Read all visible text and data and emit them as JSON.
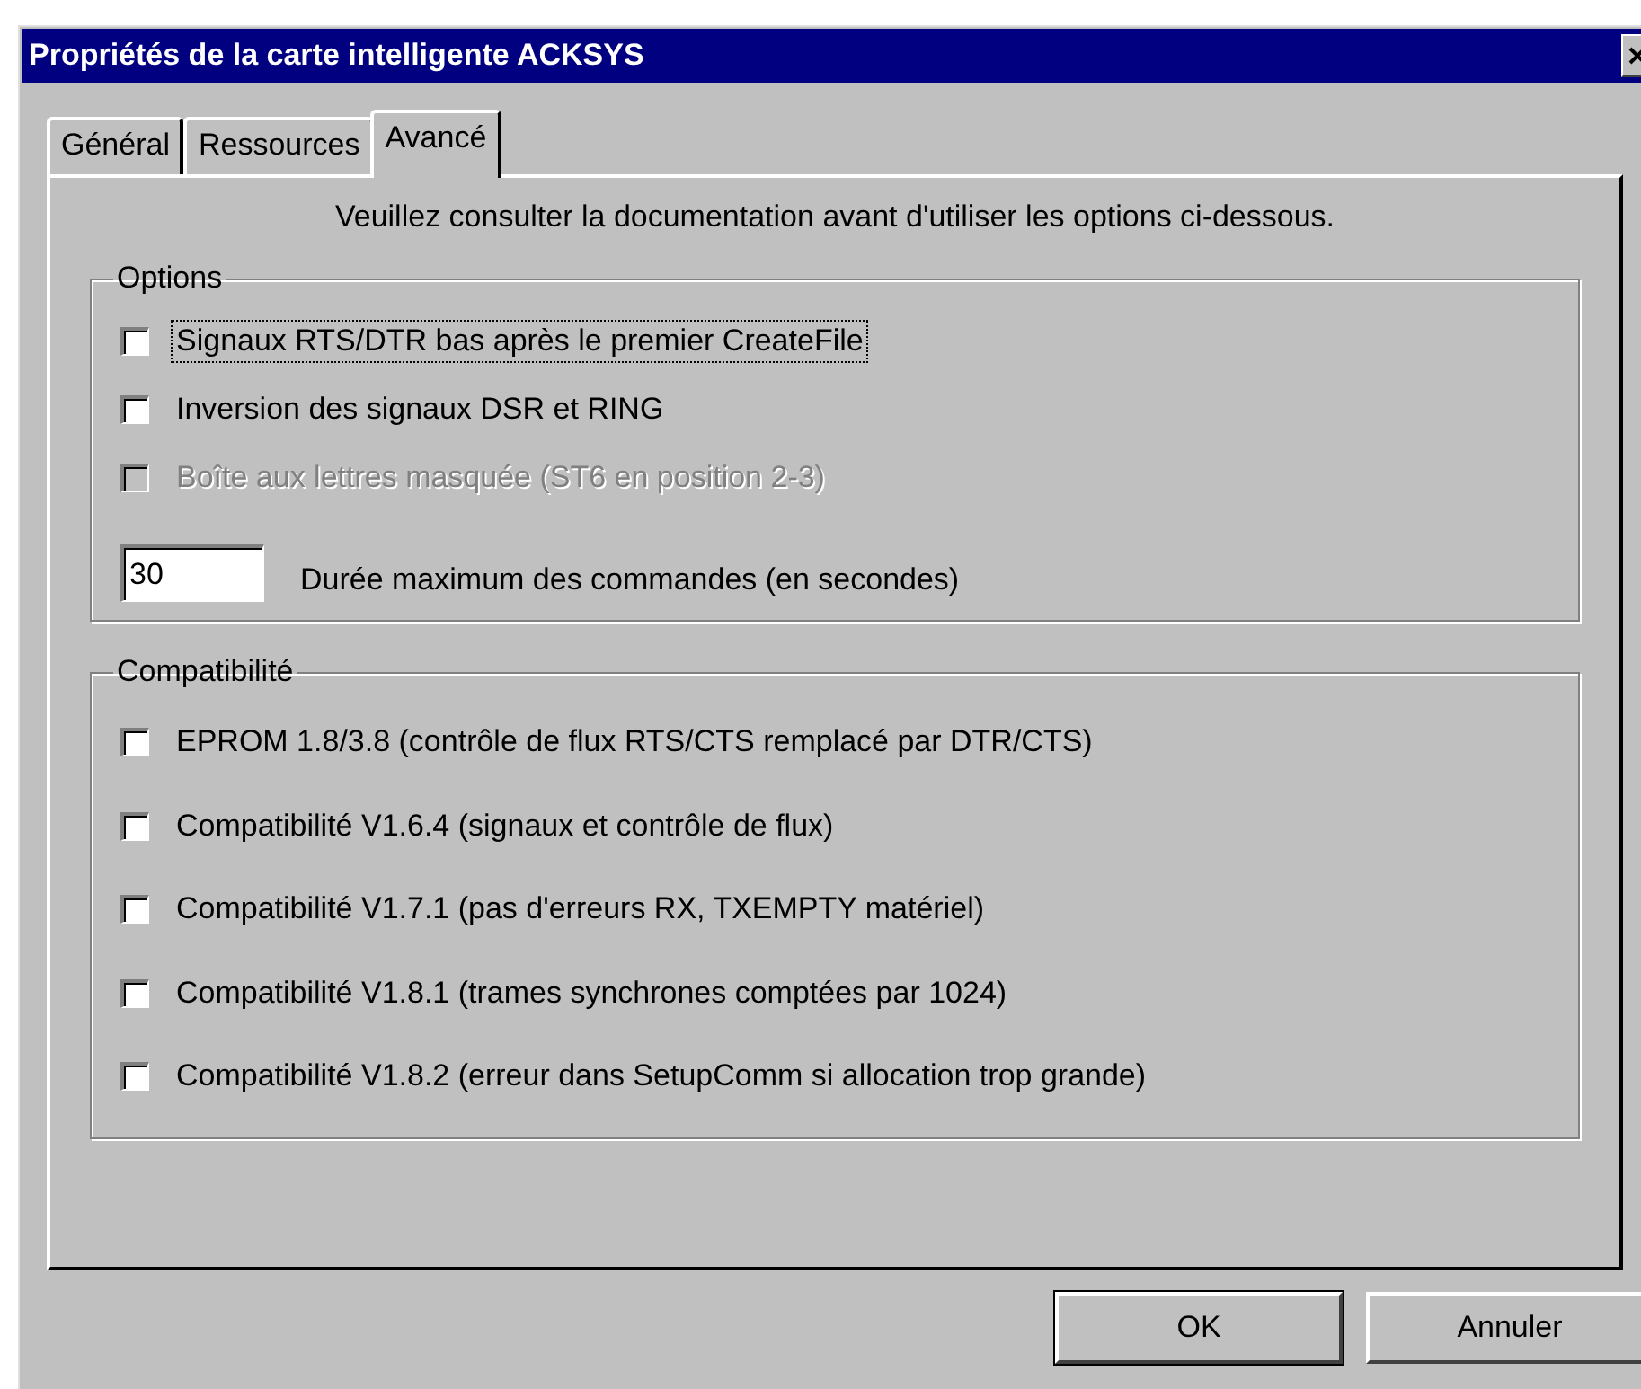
{
  "window": {
    "title": "Propriétés de la carte intelligente ACKSYS"
  },
  "tabs": [
    {
      "label": "Général",
      "selected": false
    },
    {
      "label": "Ressources",
      "selected": false
    },
    {
      "label": "Avancé",
      "selected": true
    }
  ],
  "notice": "Veuillez consulter la documentation avant d'utiliser les options ci-dessous.",
  "options": {
    "title": "Options",
    "checkboxes": [
      {
        "label": "Signaux RTS/DTR bas après le premier CreateFile",
        "checked": false,
        "disabled": false,
        "focused": true
      },
      {
        "label": "Inversion des signaux DSR et RING",
        "checked": false,
        "disabled": false,
        "focused": false
      },
      {
        "label": "Boîte aux lettres masquée (ST6 en position 2-3)",
        "checked": false,
        "disabled": true,
        "focused": false
      }
    ],
    "timeout": {
      "value": "30",
      "label": "Durée maximum des commandes (en secondes)"
    }
  },
  "compatibility": {
    "title": "Compatibilité",
    "checkboxes": [
      {
        "label": "EPROM 1.8/3.8 (contrôle de flux RTS/CTS remplacé par DTR/CTS)",
        "checked": false,
        "disabled": false,
        "focused": false
      },
      {
        "label": "Compatibilité V1.6.4 (signaux et contrôle de flux)",
        "checked": false,
        "disabled": false,
        "focused": false
      },
      {
        "label": "Compatibilité V1.7.1 (pas d'erreurs RX, TXEMPTY matériel)",
        "checked": false,
        "disabled": false,
        "focused": false
      },
      {
        "label": "Compatibilité V1.8.1 (trames synchrones comptées par 1024)",
        "checked": false,
        "disabled": false,
        "focused": false
      },
      {
        "label": "Compatibilité V1.8.2 (erreur dans SetupComm si allocation trop grande)",
        "checked": false,
        "disabled": false,
        "focused": false
      }
    ]
  },
  "buttons": [
    {
      "label": "OK",
      "default": true
    },
    {
      "label": "Annuler",
      "default": false
    }
  ]
}
